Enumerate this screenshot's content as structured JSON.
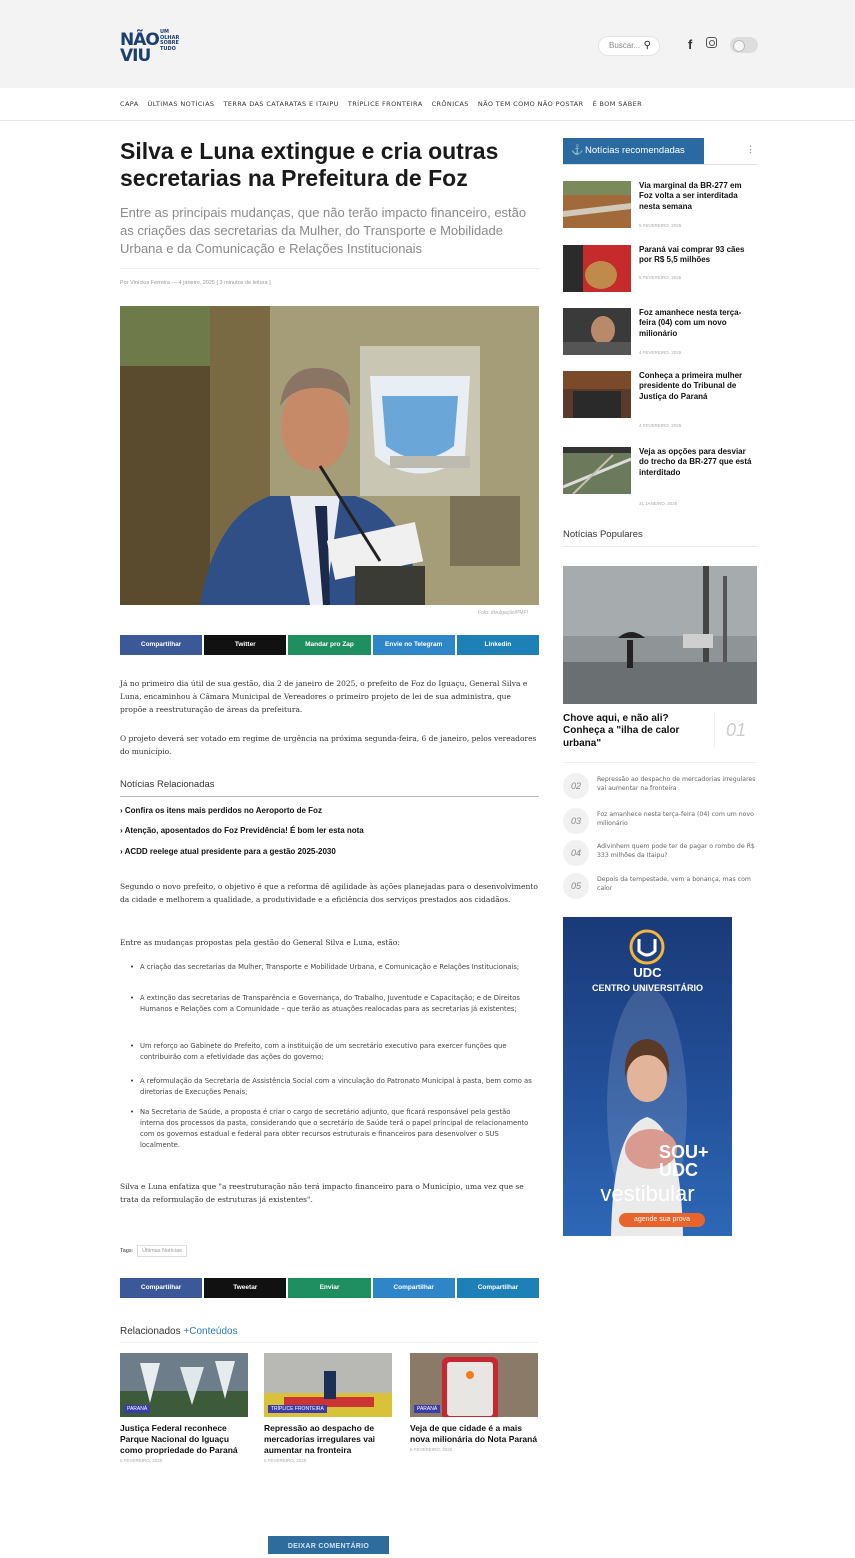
{
  "header": {
    "logo_nao": "NÃO",
    "logo_viu": "VIU",
    "logo_small": [
      "UM",
      "OLHAR",
      "SOBRE",
      "TUDO"
    ],
    "search_placeholder": "Buscar..."
  },
  "nav": [
    "CAPA",
    "ÚLTIMAS NOTÍCIAS",
    "TERRA DAS CATARATAS E ITAIPU",
    "TRÍPLICE FRONTEIRA",
    "CRÔNICAS",
    "NÃO TEM COMO NÃO POSTAR",
    "É BOM SABER"
  ],
  "article": {
    "title": "Silva e Luna extingue e cria outras secretarias na Prefeitura de Foz",
    "subtitle": "Entre as principais mudanças, que não terão impacto financeiro, estão as criações das secretarias da Mulher, do Transporte e Mobilidade Urbana e da Comunicação e Relações Institucionais",
    "byline": "Por Vinícius Ferreira  —  4 janeiro, 2025  [ 3 minutos de leitura ]",
    "image_credit": "Foto: divulgação/PMFI",
    "share_top": [
      "Compartilhar",
      "Twitter",
      "Mandar pro Zap",
      "Envie no Telegram",
      "Linkedin"
    ],
    "p1": "Já no primeiro dia útil de sua gestão, dia 2 de janeiro de 2025, o prefeito de Foz do Iguaçu, General Silva e Luna, encaminhou à Câmara Municipal de Vereadores o primeiro projeto de lei de sua administra, que propõe a reestruturação de áreas da prefeitura.",
    "p2": "O projeto deverá ser votado em regime de urgência na próxima segunda-feira, 6 de janeiro, pelos vereadores do município.",
    "related_heading": "Notícias Relacionadas",
    "related": [
      "Confira os itens mais perdidos no Aeroporto de Foz",
      "Atenção, aposentados do Foz Previdência! É bom ler esta nota",
      "ACDD reelege atual presidente para a gestão 2025-2030"
    ],
    "p3": "Segundo o novo prefeito, o objetivo é que a reforma dê agilidade às ações planejadas para o desenvolvimento da cidade e melhorem a qualidade, a produtividade e a eficiência dos serviços prestados aos cidadãos.",
    "p4": "Entre as mudanças propostas pela gestão do General Silva e Luna, estão:",
    "bullets": [
      "A criação das secretarias da Mulher, Transporte e Mobilidade Urbana, e Comunicação e Relações Institucionais;",
      "A extinção das secretarias de Transparência e Governança, do Trabalho, Juventude e Capacitação; e de Direitos Humanos e Relações com a Comunidade – que terão as atuações realocadas para as secretarias já existentes;",
      "Um reforço ao Gabinete do Prefeito, com a instituição de um secretário executivo para exercer funções que contribuirão com a efetividade das ações do governo;",
      "A reformulação da Secretaria de Assistência Social com a vinculação do Patronato Municipal à pasta, bem como as diretorias de Execuções Penais;",
      "Na Secretaria de Saúde, a proposta é criar o cargo de secretário adjunto, que ficará responsável pela gestão interna dos processos da pasta, considerando que o secretário de Saúde terá o papel principal de relacionamento com os governos estadual e federal para obter recursos estruturais e financeiros para desenvolver o SUS localmente."
    ],
    "p5": "Silva e Luna enfatiza que \"a reestruturação não terá impacto financeiro para o Município, uma vez que se trata da reformulação de estruturas já existentes\".",
    "tags_label": "Tags:",
    "tag": "Últimas Notícias",
    "share_bottom": [
      "Compartilhar",
      "Tweetar",
      "Enviar",
      "Compartilhar",
      "Compartilhar"
    ],
    "related_content_label": "Relacionados",
    "related_content_accent": "+Conteúdos",
    "cards": [
      {
        "label": "PARANÁ",
        "title": "Justiça Federal reconhece Parque Nacional do Iguaçu como propriedade do Paraná",
        "date": "6 FEVEREIRO, 2025"
      },
      {
        "label": "TRÍPLICE FRONTEIRA",
        "title": "Repressão ao despacho de mercadorias irregulares vai aumentar na fronteira",
        "date": "6 FEVEREIRO, 2025"
      },
      {
        "label": "PARANÁ",
        "title": "Veja de que cidade é a mais nova milionária do Nota Paraná",
        "date": "6 FEVEREIRO, 2025"
      }
    ],
    "comment_button": "DEIXAR COMENTÁRIO"
  },
  "sidebar": {
    "recommended_label": "Notícias recomendadas",
    "recommended": [
      {
        "title": "Via marginal da BR-277 em Foz volta a ser interditada nesta semana",
        "date": "5 FEVEREIRO, 2025"
      },
      {
        "title": "Paraná vai comprar 93 cães por R$ 5,5 milhões",
        "date": "5 FEVEREIRO, 2025"
      },
      {
        "title": "Foz amanhece nesta terça-feira (04) com um novo milionário",
        "date": "4 FEVEREIRO, 2025"
      },
      {
        "title": "Conheça a primeira mulher presidente do Tribunal de Justiça do Paraná",
        "date": "4 FEVEREIRO, 2025"
      },
      {
        "title": "Veja as opções para desviar do trecho da BR-277 que está interditado",
        "date": "31 JANEIRO, 2025"
      }
    ],
    "popular_label": "Notícias Populares",
    "popular_main": {
      "title": "Chove aqui, e não ali? Conheça a \"ilha de calor urbana\"",
      "number": "01"
    },
    "popular": [
      {
        "number": "02",
        "title": "Repressão ao despacho de mercadorias irregulares vai aumentar na fronteira"
      },
      {
        "number": "03",
        "title": "Foz amanhece nesta terça-feira (04) com um novo milionário"
      },
      {
        "number": "04",
        "title": "Adivinhem quem pode ter de pagar o rombo de R$ 333 milhões da Itaipu?"
      },
      {
        "number": "05",
        "title": "Depois da tempestade, vem a bonança, mas com calor"
      }
    ],
    "ad": {
      "brand": "UDC",
      "line1": "CENTRO UNIVERSITÁRIO",
      "sou": "SOU+",
      "udc2": "UDC",
      "vestibular": "vestibular",
      "cta": "agende sua prova"
    }
  },
  "colors": {
    "facebook": "#3b5998",
    "twitter": "#111111",
    "whatsapp": "#1f8f5f",
    "telegram": "#2e86c8",
    "linkedin": "#1d80b7",
    "accent": "#2b6aa0"
  }
}
